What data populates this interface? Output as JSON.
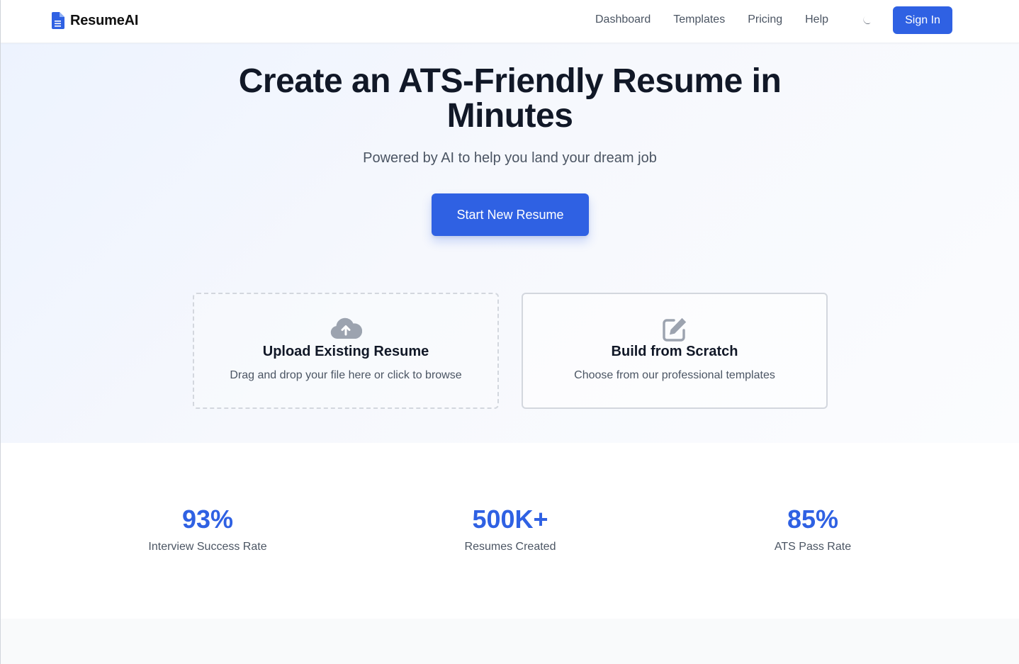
{
  "brand": {
    "name": "ResumeAI",
    "accent": "#2f61e3"
  },
  "nav": {
    "items": [
      "Dashboard",
      "Templates",
      "Pricing",
      "Help"
    ],
    "theme_icon": "moon-icon",
    "sign_in_label": "Sign In"
  },
  "hero": {
    "title": "Create an ATS-Friendly Resume in Minutes",
    "subtitle": "Powered by AI to help you land your dream job",
    "cta_label": "Start New Resume"
  },
  "options": [
    {
      "icon": "cloud-upload-icon",
      "title": "Upload Existing Resume",
      "description": "Drag and drop your file here or click to browse"
    },
    {
      "icon": "edit-icon",
      "title": "Build from Scratch",
      "description": "Choose from our professional templates"
    }
  ],
  "stats": [
    {
      "value": "93%",
      "label": "Interview Success Rate"
    },
    {
      "value": "500K+",
      "label": "Resumes Created"
    },
    {
      "value": "85%",
      "label": "ATS Pass Rate"
    }
  ]
}
